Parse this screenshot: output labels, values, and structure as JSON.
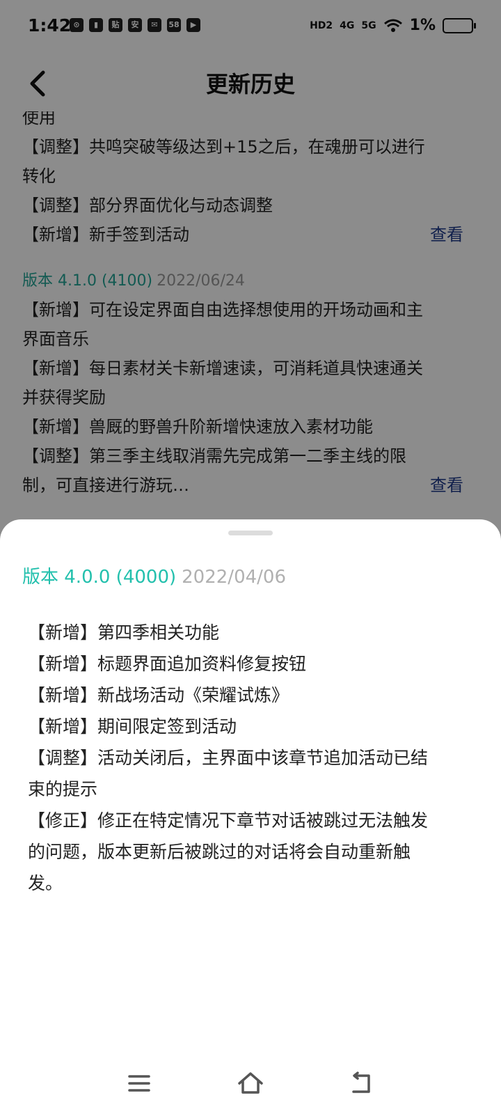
{
  "status_bar": {
    "time": "1:42",
    "left_icons": [
      "weibo-icon",
      "battery-saver-icon",
      "tieba-icon",
      "app-icon-an",
      "wechat-icon",
      "app-58-icon",
      "media-icon"
    ],
    "left_icon_labels": [
      "⊙",
      "▮",
      "贴",
      "安",
      "✉",
      "58",
      "▶"
    ],
    "hd": "HD2",
    "net_4g": "4G",
    "net_5g": "5G",
    "battery": "1%"
  },
  "header": {
    "title": "更新历史"
  },
  "background_list": {
    "lines_top": [
      "使用",
      "【调整】共鸣突破等级达到+15之后，在魂册可以进行",
      "转化",
      "【调整】部分界面优化与动态调整"
    ],
    "last_line": "【新增】新手签到活动",
    "more_label": "查看",
    "version2": {
      "version": "版本 4.1.0 (4100)",
      "date": "2022/06/24",
      "lines": [
        "【新增】可在设定界面自由选择想使用的开场动画和主",
        "界面音乐",
        "【新增】每日素材关卡新增速读，可消耗道具快速通关",
        "并获得奖励",
        "【新增】兽厩的野兽升阶新增快速放入素材功能",
        "【调整】第三季主线取消需先完成第一二季主线的限"
      ],
      "last_line": "制，可直接进行游玩…",
      "more_label": "查看"
    }
  },
  "sheet": {
    "version": "版本 4.0.0 (4000)",
    "date": "2022/04/06",
    "notes": [
      "【新增】第四季相关功能",
      "【新增】标题界面追加资料修复按钮",
      "【新增】新战场活动《荣耀试炼》",
      "【新增】期间限定签到活动",
      "【调整】活动关闭后，主界面中该章节追加活动已结",
      "束的提示",
      "【修正】修正在特定情况下章节对话被跳过无法触发",
      "的问题，版本更新后被跳过的对话将会自动重新触",
      "发。"
    ]
  },
  "nav": {
    "icons": [
      "menu-icon",
      "home-icon",
      "back-icon"
    ]
  }
}
